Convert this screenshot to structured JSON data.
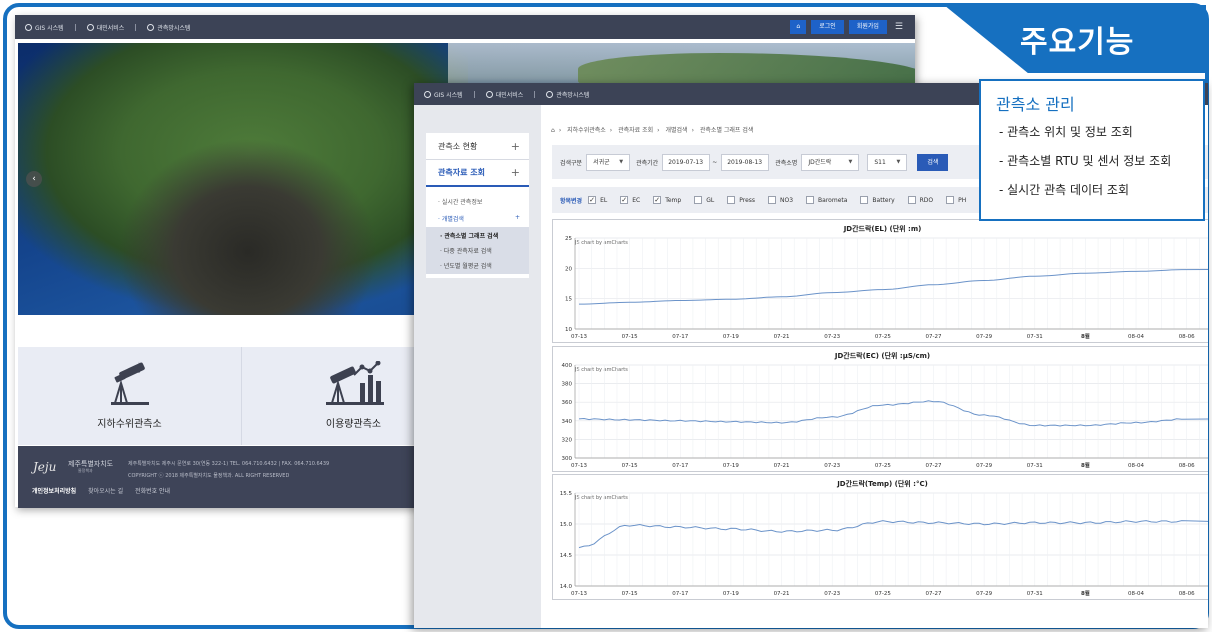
{
  "callout": {
    "title": "주요기능",
    "heading": "관측소 관리",
    "items": [
      "- 관측소 위치 및 정보 조회",
      "- 관측소별 RTU 및 센서 정보 조회",
      "- 실시간 관측 데이터 조회"
    ]
  },
  "back": {
    "topnav": [
      "GIS 시스템",
      "대민서비스",
      "관측망시스템"
    ],
    "buttons": {
      "login": "로그인",
      "join": "회원가입"
    },
    "cards": [
      "지하수위관측소",
      "이용량관측소"
    ],
    "footer": {
      "logo": "Jeju",
      "org": "제주특별자치도",
      "org_sub": "물정책과",
      "address": "제주특별자치도 제주시 문연로 30(연동 322-1) TEL. 064.710.6432 | FAX. 064.710.6439",
      "copyright": "COPYRIGHT ⓒ 2018 제주특별자치도 물정책과. ALL RIGHT RESERVED",
      "links": [
        "개인정보처리방침",
        "찾아오시는 길",
        "전화번호 안내"
      ]
    }
  },
  "front": {
    "topnav": [
      "GIS 시스템",
      "대민서비스",
      "관측망시스템"
    ],
    "side": {
      "menu1": "관측소 현황",
      "menu2": "관측자료 조회",
      "sub1": "· 실시간 관측정보",
      "sub2": "· 개별검색",
      "subsub": [
        "· 관측소별 그래프 검색",
        "· 다중 관측자료 검색",
        "· 년도별 월평균 검색"
      ]
    },
    "breadcrumb": [
      "지하수위관측소",
      "관측자료 조회",
      "개별검색",
      "관측소별 그래프 검색"
    ],
    "search": {
      "region_label": "검색구분",
      "region": "서귀군",
      "period_label": "관측기간",
      "from": "2019-07-13",
      "to": "2019-08-13",
      "tilde": "~",
      "station_label": "관측소명",
      "station": "JD간드락",
      "code": "S11",
      "button": "검색"
    },
    "items": {
      "title": "항목변경",
      "list": [
        {
          "label": "EL",
          "checked": true
        },
        {
          "label": "EC",
          "checked": true
        },
        {
          "label": "Temp",
          "checked": true
        },
        {
          "label": "GL",
          "checked": false
        },
        {
          "label": "Press",
          "checked": false
        },
        {
          "label": "NO3",
          "checked": false
        },
        {
          "label": "Barometa",
          "checked": false
        },
        {
          "label": "Battery",
          "checked": false
        },
        {
          "label": "RDO",
          "checked": false
        },
        {
          "label": "PH",
          "checked": false
        }
      ]
    }
  },
  "chart_data": [
    {
      "type": "line",
      "title": "JD간드락(EL) (단위 :m)",
      "credit": "JS chart by amCharts",
      "x": [
        "07-13",
        "07-15",
        "07-17",
        "07-19",
        "07-21",
        "07-23",
        "07-25",
        "07-27",
        "07-29",
        "07-31",
        "8월",
        "08-04",
        "08-06"
      ],
      "ylim": [
        10,
        25
      ],
      "yticks": [
        "25",
        "20",
        "15",
        "10"
      ],
      "series": [
        {
          "values": [
            14.1,
            14.4,
            14.7,
            14.9,
            15.3,
            16.0,
            16.5,
            17.3,
            18.0,
            18.7,
            19.2,
            19.5,
            19.8
          ]
        }
      ]
    },
    {
      "type": "line",
      "title": "JD간드락(EC) (단위 :µS/cm)",
      "credit": "JS chart by amCharts",
      "x": [
        "07-13",
        "07-15",
        "07-17",
        "07-19",
        "07-21",
        "07-23",
        "07-25",
        "07-27",
        "07-29",
        "07-31",
        "8월",
        "08-04",
        "08-06"
      ],
      "ylim": [
        300,
        400
      ],
      "yticks": [
        "400",
        "380",
        "360",
        "340",
        "320",
        "300"
      ],
      "series": [
        {
          "values": [
            342,
            341,
            340,
            339,
            338,
            344,
            357,
            361,
            346,
            335,
            335,
            338,
            342
          ]
        }
      ]
    },
    {
      "type": "line",
      "title": "JD간드락(Temp) (단위 :°C)",
      "credit": "JS chart by amCharts",
      "x": [
        "07-13",
        "07-15",
        "07-17",
        "07-19",
        "07-21",
        "07-23",
        "07-25",
        "07-27",
        "07-29",
        "07-31",
        "8월",
        "08-04",
        "08-06"
      ],
      "ylim": [
        14,
        15.5
      ],
      "yticks": [
        "15.5",
        "15.0",
        "14.5",
        "14.0"
      ],
      "series": [
        {
          "values": [
            14.62,
            14.98,
            14.95,
            14.92,
            14.88,
            14.9,
            15.04,
            15.02,
            15.0,
            15.02,
            15.02,
            15.04,
            15.04
          ]
        }
      ]
    }
  ]
}
